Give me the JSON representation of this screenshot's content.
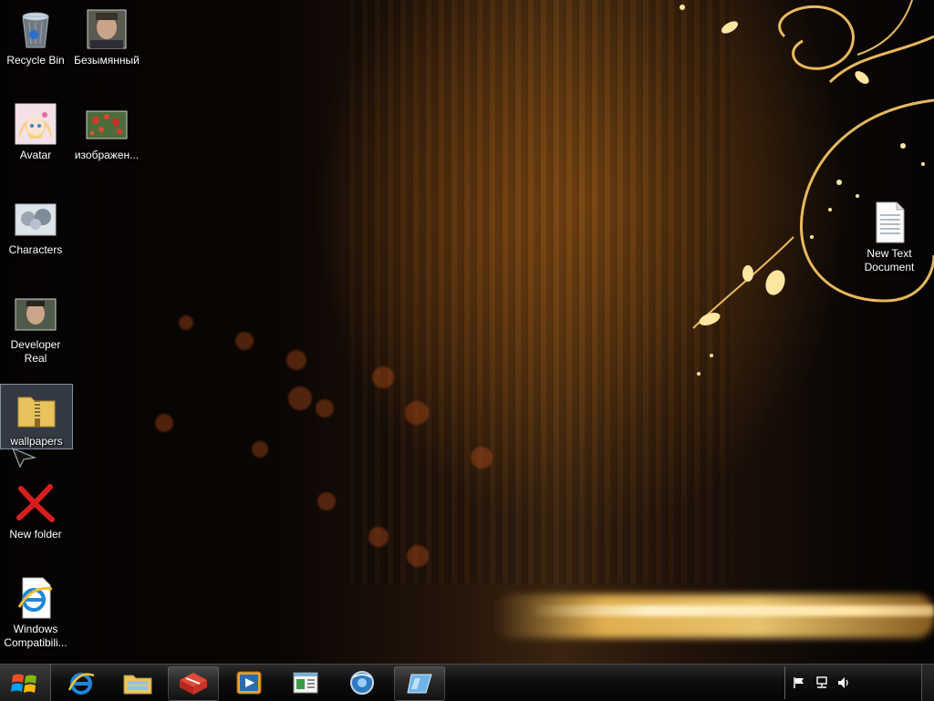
{
  "desktop_icons": [
    {
      "label": "Recycle Bin",
      "icon": "recycle-bin-icon"
    },
    {
      "label": "Безымянный",
      "icon": "photo-person-icon"
    },
    {
      "label": "Avatar",
      "icon": "anime-avatar-icon"
    },
    {
      "label": "изображен...",
      "icon": "flowers-image-icon"
    },
    {
      "label": "Characters",
      "icon": "characters-image-icon"
    },
    {
      "label": "Developer Real",
      "icon": "photo-person-icon"
    },
    {
      "label": "wallpapers",
      "icon": "zip-folder-icon",
      "selected": true
    },
    {
      "label": "New folder",
      "icon": "red-x-icon"
    },
    {
      "label": "Windows Compatibili...",
      "icon": "ie-document-icon"
    },
    {
      "label": "New Text Document",
      "icon": "text-document-icon"
    }
  ],
  "taskbar": {
    "start": "windows-start-icon",
    "pinned": [
      "internet-explorer-icon",
      "file-explorer-icon",
      "red-package-icon",
      "media-player-icon",
      "window-app-icon",
      "browser-globe-icon",
      "blue-glass-icon"
    ],
    "tray": [
      "action-center-flag-icon",
      "network-icon",
      "volume-icon"
    ]
  },
  "colors": {
    "accent": "#f2b64a",
    "taskbar": "#0e0e0e"
  }
}
